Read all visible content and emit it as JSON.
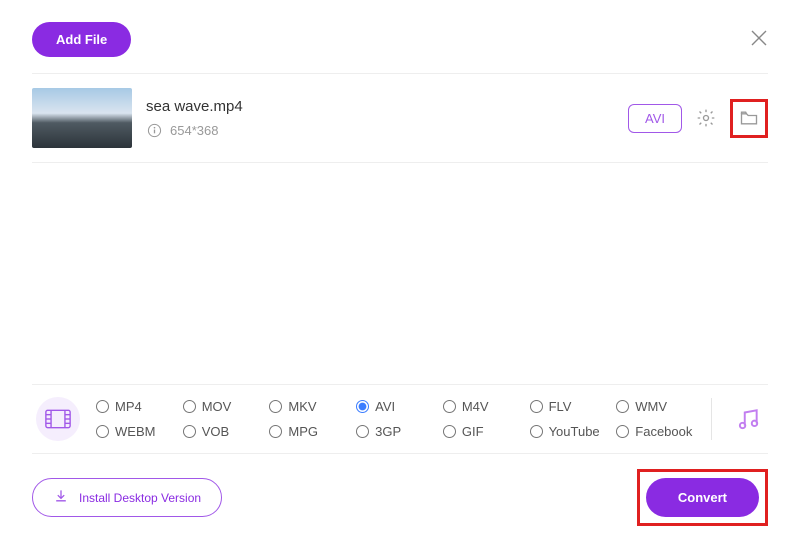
{
  "header": {
    "add_file_label": "Add File"
  },
  "file": {
    "name": "sea wave.mp4",
    "resolution": "654*368",
    "selected_format": "AVI"
  },
  "formats": {
    "options": [
      "MP4",
      "MOV",
      "MKV",
      "AVI",
      "M4V",
      "FLV",
      "WMV",
      "WEBM",
      "VOB",
      "MPG",
      "3GP",
      "GIF",
      "YouTube",
      "Facebook"
    ],
    "selected": "AVI"
  },
  "footer": {
    "install_label": "Install Desktop Version",
    "convert_label": "Convert"
  }
}
